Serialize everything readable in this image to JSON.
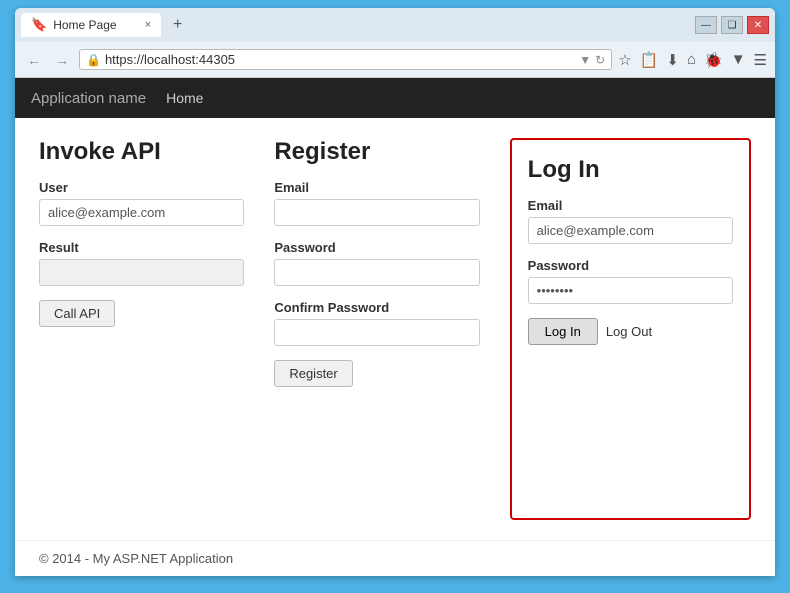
{
  "browser": {
    "tab_label": "Home Page",
    "tab_close": "×",
    "tab_new": "+",
    "url": "https://localhost:44305",
    "win_minimize": "—",
    "win_restore": "❑",
    "win_close": "✕"
  },
  "navbar": {
    "app_name": "Application name",
    "nav_home": "Home"
  },
  "invoke_api": {
    "title": "Invoke API",
    "user_label": "User",
    "user_placeholder": "alice@example.com",
    "result_label": "Result",
    "result_value": "",
    "call_api_btn": "Call API"
  },
  "register": {
    "title": "Register",
    "email_label": "Email",
    "email_value": "",
    "password_label": "Password",
    "password_value": "",
    "confirm_label": "Confirm Password",
    "confirm_value": "",
    "register_btn": "Register"
  },
  "login": {
    "title": "Log In",
    "email_label": "Email",
    "email_value": "alice@example.com",
    "password_label": "Password",
    "password_value": "••••••••",
    "login_btn": "Log In",
    "logout_btn": "Log Out"
  },
  "footer": {
    "text": "© 2014 - My ASP.NET Application"
  }
}
